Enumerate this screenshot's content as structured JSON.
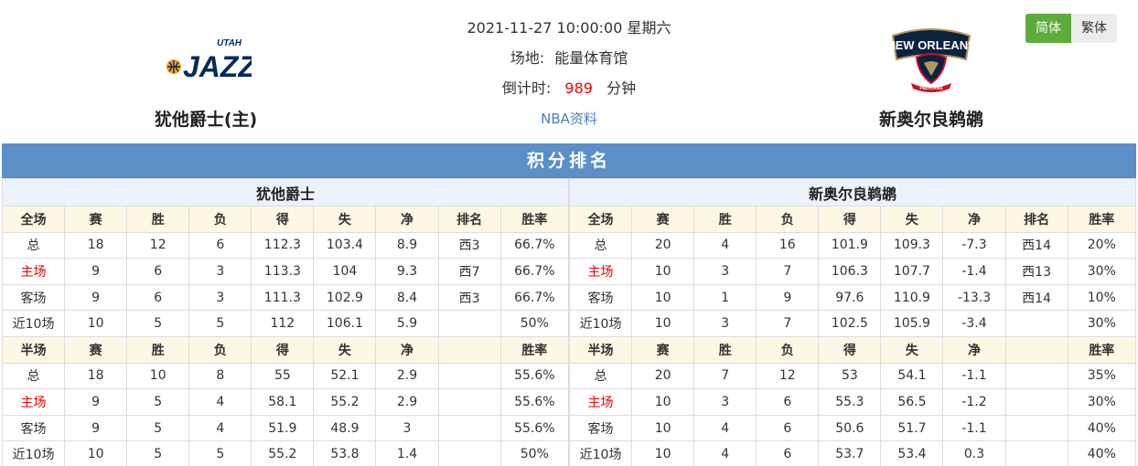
{
  "match": {
    "datetime": "2021-11-27 10:00:00 星期六",
    "venue_label": "场地:",
    "venue": "能量体育馆",
    "countdown_label": "倒计时:",
    "countdown_value": "989",
    "countdown_unit": "分钟",
    "nba_link": "NBA资料"
  },
  "home_team": {
    "name": "犹他爵士(主)",
    "logo_top": "UTAH",
    "logo_main": "JAZZ"
  },
  "away_team": {
    "name": "新奥尔良鹈鹕",
    "logo_top": "NEW ORLEANS",
    "logo_bottom": "PELICANS"
  },
  "lang": {
    "simplified": "简体",
    "traditional": "繁体"
  },
  "section_title": "积分排名",
  "colors": {
    "accent": "#5b8fc6",
    "green": "#5cac3b",
    "highlight": "#e00000"
  },
  "tables": [
    {
      "team": "犹他爵士",
      "full_header": [
        "全场",
        "赛",
        "胜",
        "负",
        "得",
        "失",
        "净",
        "排名",
        "胜率"
      ],
      "full_rows": [
        [
          "总",
          "18",
          "12",
          "6",
          "112.3",
          "103.4",
          "8.9",
          "西3",
          "66.7%"
        ],
        [
          "主场",
          "9",
          "6",
          "3",
          "113.3",
          "104",
          "9.3",
          "西7",
          "66.7%"
        ],
        [
          "客场",
          "9",
          "6",
          "3",
          "111.3",
          "102.9",
          "8.4",
          "西3",
          "66.7%"
        ],
        [
          "近10场",
          "10",
          "5",
          "5",
          "112",
          "106.1",
          "5.9",
          "",
          "50%"
        ]
      ],
      "half_header": [
        "半场",
        "赛",
        "胜",
        "负",
        "得",
        "失",
        "净",
        "",
        "胜率"
      ],
      "half_rows": [
        [
          "总",
          "18",
          "10",
          "8",
          "55",
          "52.1",
          "2.9",
          "",
          "55.6%"
        ],
        [
          "主场",
          "9",
          "5",
          "4",
          "58.1",
          "55.2",
          "2.9",
          "",
          "55.6%"
        ],
        [
          "客场",
          "9",
          "5",
          "4",
          "51.9",
          "48.9",
          "3",
          "",
          "55.6%"
        ],
        [
          "近10场",
          "10",
          "5",
          "5",
          "55.2",
          "53.8",
          "1.4",
          "",
          "50%"
        ]
      ]
    },
    {
      "team": "新奥尔良鹈鹕",
      "full_header": [
        "全场",
        "赛",
        "胜",
        "负",
        "得",
        "失",
        "净",
        "排名",
        "胜率"
      ],
      "full_rows": [
        [
          "总",
          "20",
          "4",
          "16",
          "101.9",
          "109.3",
          "-7.3",
          "西14",
          "20%"
        ],
        [
          "主场",
          "10",
          "3",
          "7",
          "106.3",
          "107.7",
          "-1.4",
          "西13",
          "30%"
        ],
        [
          "客场",
          "10",
          "1",
          "9",
          "97.6",
          "110.9",
          "-13.3",
          "西14",
          "10%"
        ],
        [
          "近10场",
          "10",
          "3",
          "7",
          "102.5",
          "105.9",
          "-3.4",
          "",
          "30%"
        ]
      ],
      "half_header": [
        "半场",
        "赛",
        "胜",
        "负",
        "得",
        "失",
        "净",
        "",
        "胜率"
      ],
      "half_rows": [
        [
          "总",
          "20",
          "7",
          "12",
          "53",
          "54.1",
          "-1.1",
          "",
          "35%"
        ],
        [
          "主场",
          "10",
          "3",
          "6",
          "55.3",
          "56.5",
          "-1.2",
          "",
          "30%"
        ],
        [
          "客场",
          "10",
          "4",
          "6",
          "50.6",
          "51.7",
          "-1.1",
          "",
          "40%"
        ],
        [
          "近10场",
          "10",
          "4",
          "6",
          "53.7",
          "53.4",
          "0.3",
          "",
          "40%"
        ]
      ]
    }
  ]
}
